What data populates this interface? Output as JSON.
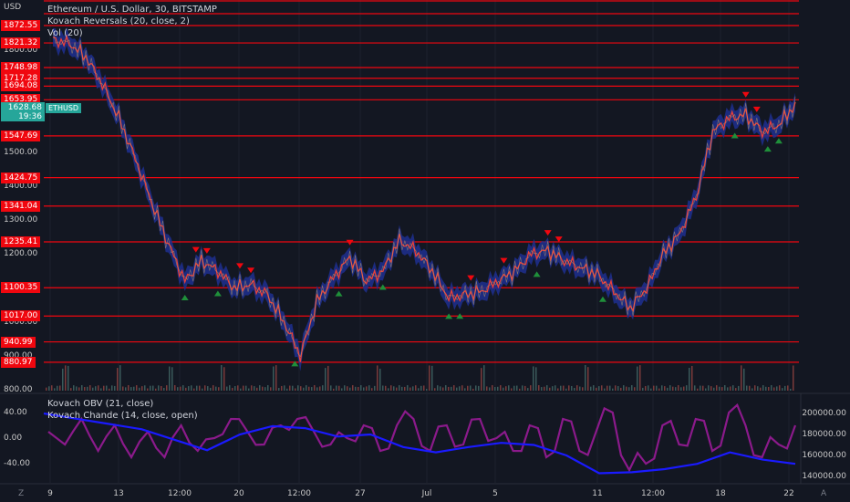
{
  "header": {
    "currency": "USD"
  },
  "legend": {
    "title": "Ethereum / U.S. Dollar, 30, BITSTAMP",
    "reversals": "Kovach Reversals (20, close, 2)",
    "vol": "Vol (20)",
    "obv": "Kovach OBV (21, close)",
    "chande": "Kovach Chande (14, close, open)"
  },
  "price_box": {
    "price": "1628.68",
    "time": "19:36",
    "symbol": "ETHUSD"
  },
  "levels": [
    "1872.55",
    "1821.32",
    "1748.98",
    "1717.28",
    "1694.08",
    "1653.95",
    "1547.69",
    "1424.75",
    "1341.04",
    "1235.41",
    "1100.35",
    "1017.00",
    "940.99",
    "880.97"
  ],
  "price_axis": [
    "1800.00",
    "1700.00",
    "1600.00",
    "1500.00",
    "1400.00",
    "1300.00",
    "1200.00",
    "1100.00",
    "1000.00",
    "900.00",
    "800.00"
  ],
  "chande_axis": [
    "40.00",
    "0.00",
    "-40.00"
  ],
  "obv_axis": [
    "200000.00",
    "180000.00",
    "160000.00",
    "140000.00"
  ],
  "x_axis": [
    "9",
    "13",
    "12:00",
    "20",
    "12:00",
    "27",
    "Jul",
    "5",
    "11",
    "12:00",
    "18",
    "22"
  ],
  "corner": {
    "left": "Z",
    "right": "A"
  },
  "colors": {
    "background": "#131722",
    "level": "#f0070f",
    "up": "#26a69a",
    "obv": "#1a1aff",
    "chande": "#8b1a8b",
    "band": "#2436a8"
  },
  "chart_data": {
    "type": "line",
    "price_series_approx": [
      1830,
      1820,
      1780,
      1700,
      1600,
      1480,
      1350,
      1230,
      1120,
      1180,
      1150,
      1100,
      1110,
      1080,
      1000,
      900,
      1060,
      1130,
      1190,
      1120,
      1150,
      1240,
      1210,
      1150,
      1070,
      1080,
      1090,
      1120,
      1150,
      1200,
      1210,
      1180,
      1160,
      1140,
      1090,
      1040,
      1100,
      1200,
      1260,
      1370,
      1560,
      1600,
      1610,
      1560,
      1580,
      1640
    ],
    "chande_series_approx": [
      10,
      -10,
      30,
      -20,
      20,
      -30,
      10,
      -30,
      20,
      -20,
      0,
      30,
      10,
      -10,
      20,
      30,
      10,
      -10,
      0,
      20,
      -20,
      20,
      30,
      -20,
      20,
      -10,
      30,
      0,
      -20,
      20,
      -30,
      30,
      -20,
      10,
      40,
      -50,
      -40,
      20,
      -10,
      30,
      -20,
      40,
      20,
      -30,
      -10,
      20
    ],
    "obv_series_approx": [
      200000,
      195000,
      190000,
      185000,
      175000,
      165000,
      180000,
      188000,
      186000,
      178000,
      180000,
      168000,
      163000,
      168000,
      172000,
      170000,
      160000,
      143000,
      144000,
      147000,
      152000,
      163000,
      156000,
      152000
    ]
  }
}
